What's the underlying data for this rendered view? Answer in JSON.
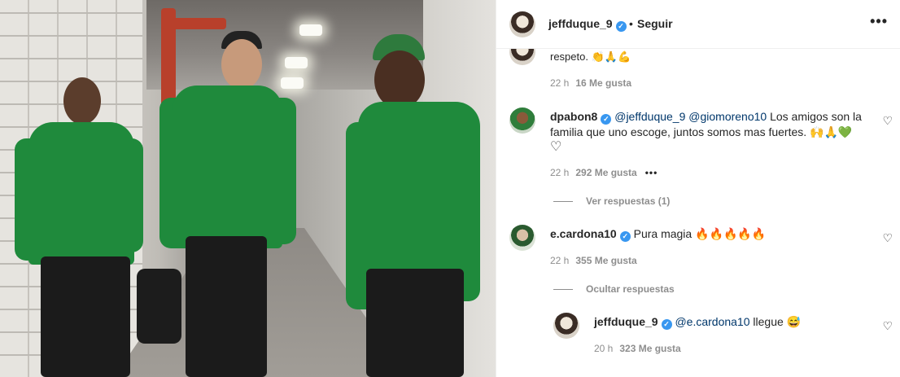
{
  "post": {
    "author": "jeffduque_9",
    "follow_label": "Seguir",
    "separator": "•",
    "more_icon": "more-horizontal-icon",
    "verified_mark": "✓"
  },
  "comments": [
    {
      "text_tail": "respeto. 👏🙏💪",
      "time": "22 h",
      "likes": "16 Me gusta"
    },
    {
      "user": "dpabon8",
      "mention1": "@jeffduque_9",
      "mention2": "@giomoreno10",
      "text": " Los amigos son la familia que uno escoge, juntos somos mas fuertes. 🙌🙏💚",
      "heart_line": "♡",
      "time": "22 h",
      "likes": "292 Me gusta",
      "more": "•••",
      "view_replies": "Ver respuestas (1)"
    },
    {
      "user": "e.cardona10",
      "text": "Pura magia 🔥🔥🔥🔥🔥",
      "time": "22 h",
      "likes": "355 Me gusta",
      "hide_replies": "Ocultar respuestas"
    },
    {
      "user": "jeffduque_9",
      "mention": "@e.cardona10",
      "text": " llegue 😅",
      "time": "20 h",
      "likes": "323 Me gusta"
    }
  ],
  "icons": {
    "heart": "♡",
    "like_icon": "heart-outline-icon"
  },
  "colors": {
    "verified": "#3897f0",
    "mention": "#00376b",
    "meta": "#8e8e8e"
  }
}
